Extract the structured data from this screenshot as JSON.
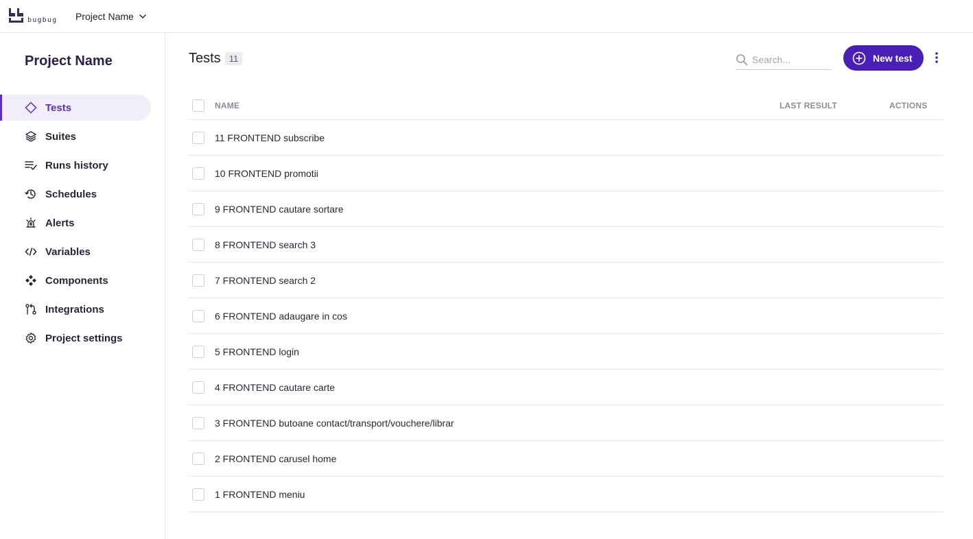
{
  "brand": {
    "logo_text": "bugbug",
    "accent": "#4a1fb8"
  },
  "topbar": {
    "project_name": "Project Name"
  },
  "sidebar": {
    "title": "Project Name",
    "items": [
      {
        "label": "Tests",
        "icon": "diamond-icon",
        "active": true
      },
      {
        "label": "Suites",
        "icon": "layers-icon"
      },
      {
        "label": "Runs history",
        "icon": "list-check-icon"
      },
      {
        "label": "Schedules",
        "icon": "history-icon"
      },
      {
        "label": "Alerts",
        "icon": "alarm-icon"
      },
      {
        "label": "Variables",
        "icon": "code-icon"
      },
      {
        "label": "Components",
        "icon": "components-icon"
      },
      {
        "label": "Integrations",
        "icon": "git-pull-icon"
      },
      {
        "label": "Project settings",
        "icon": "gear-icon"
      }
    ]
  },
  "main": {
    "title": "Tests",
    "count": "11",
    "search_placeholder": "Search...",
    "new_test_label": "New test",
    "columns": {
      "name": "NAME",
      "last_result": "LAST RESULT",
      "actions": "ACTIONS"
    },
    "rows": [
      {
        "name": "11 FRONTEND subscribe"
      },
      {
        "name": "10 FRONTEND promotii"
      },
      {
        "name": "9 FRONTEND cautare sortare"
      },
      {
        "name": "8 FRONTEND search 3"
      },
      {
        "name": "7 FRONTEND search 2"
      },
      {
        "name": "6 FRONTEND adaugare in cos"
      },
      {
        "name": "5 FRONTEND login"
      },
      {
        "name": "4 FRONTEND cautare carte"
      },
      {
        "name": "3 FRONTEND butoane contact/transport/vouchere/librar"
      },
      {
        "name": "2 FRONTEND carusel home"
      },
      {
        "name": "1 FRONTEND meniu"
      }
    ]
  }
}
